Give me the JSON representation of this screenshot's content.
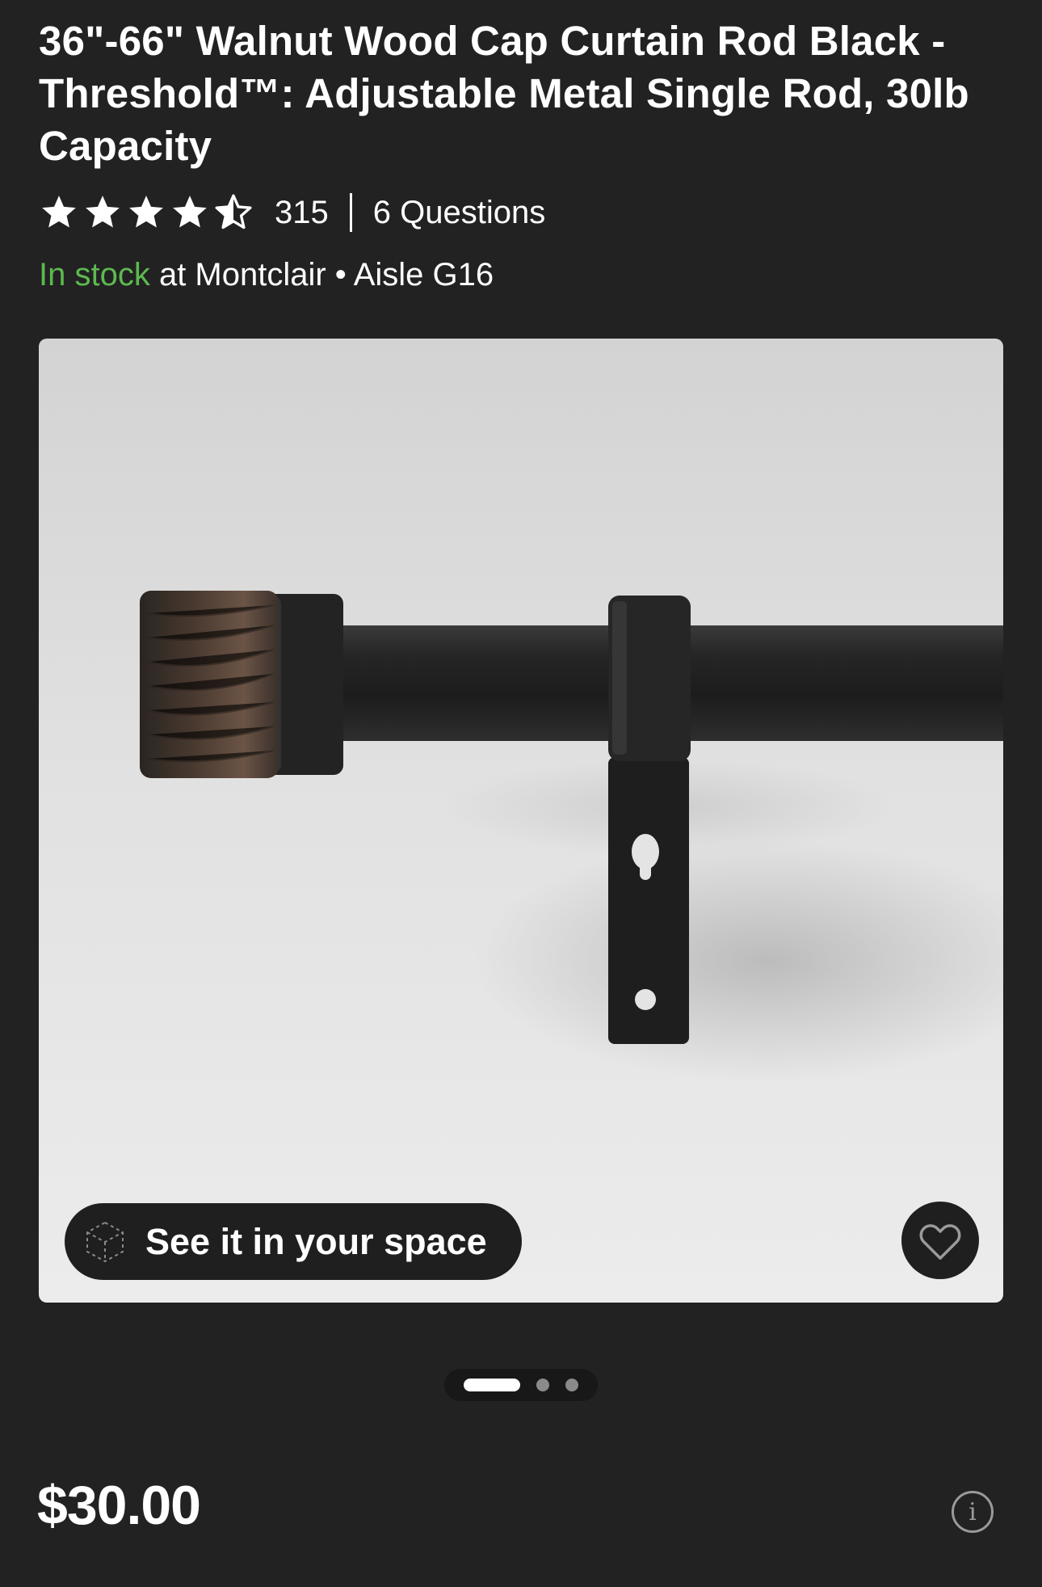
{
  "product": {
    "title": "36\"-66\" Walnut Wood Cap Curtain Rod Black - Threshold™: Adjustable Metal Single Rod, 30lb Capacity",
    "rating_value": 4.5,
    "rating_count": "315",
    "questions": "6 Questions"
  },
  "availability": {
    "status": "In stock",
    "location": " at Montclair • Aisle G16",
    "status_color": "#5db950"
  },
  "gallery": {
    "ar_label": "See it in your space",
    "total_images": 3,
    "active_index": 0
  },
  "pricing": {
    "price": "$30.00",
    "info_symbol": "i"
  },
  "icons": [
    "star-icon",
    "half-star-icon",
    "cube-ar-icon",
    "heart-icon",
    "info-icon"
  ]
}
